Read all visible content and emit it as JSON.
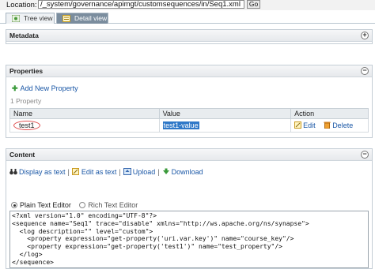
{
  "location": {
    "label": "Location:",
    "path": "/_system/governance/apimgt/customsequences/in/Seq1.xml",
    "go_label": "Go"
  },
  "tabs": [
    {
      "label": "Tree view",
      "icon": "tree-icon",
      "active": false
    },
    {
      "label": "Detail view",
      "icon": "detail-icon",
      "active": true
    }
  ],
  "metadata": {
    "title": "Metadata",
    "toggle": "+"
  },
  "properties": {
    "title": "Properties",
    "toggle": "−",
    "add_label": "Add New Property",
    "count_label": "1 Property",
    "headers": [
      "Name",
      "Value",
      "Action"
    ],
    "rows": [
      {
        "name": "test1",
        "value": "test1-value",
        "edit": "Edit",
        "delete": "Delete"
      }
    ]
  },
  "content": {
    "title": "Content",
    "toggle": "−",
    "actions": [
      "Display as text",
      "Edit as text",
      "Upload",
      "Download"
    ],
    "editor_modes": [
      "Plain Text Editor",
      "Rich Text Editor"
    ],
    "selected_mode": "Plain Text Editor",
    "xml_lines": [
      "<?xml version=\"1.0\" encoding=\"UTF-8\"?>",
      "<sequence name=\"Seq1\" trace=\"disable\" xmlns=\"http://ws.apache.org/ns/synapse\">",
      "  <log description=\"\" level=\"custom\">",
      "    <property expression=\"get-property('uri.var.key')\" name=\"course_key\"/>",
      "    <property expression=\"get-property('test1')\" name=\"test_property\"/>",
      "  </log>",
      "</sequence>"
    ]
  },
  "colors": {
    "link": "#1a57a6",
    "active_tab": "#7b8d9e",
    "highlight": "#2f78c8",
    "annotation": "#e05050"
  }
}
